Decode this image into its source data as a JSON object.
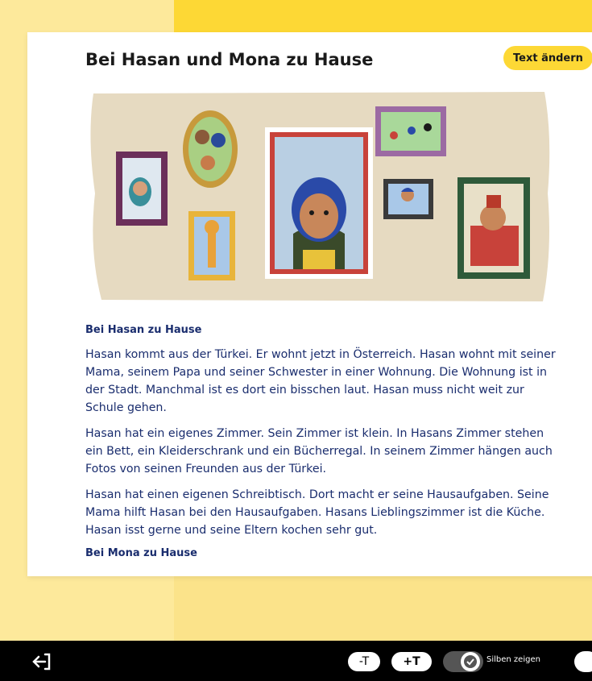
{
  "page": {
    "title": "Bei Hasan und Mona zu Hause",
    "edit_button": "Text ändern"
  },
  "colors": {
    "accent": "#fdd835",
    "text_blue": "#1a2d6e",
    "syllable_red": "#e02020"
  },
  "illustration": {
    "semantic": "family-portrait-wall-illustration"
  },
  "content": {
    "heading": "Bei Hasan zu Hause",
    "paragraphs": [
      "Hasan kommt aus der Türkei. Er wohnt jetzt in Österreich. Hasan wohnt mit seiner Mama, seinem Papa und seiner Schwester in einer Wohnung. Die Wohnung ist in der Stadt. Manchmal ist es dort ein bisschen laut. Hasan muss nicht weit zur Schule gehen.",
      "Hasan hat ein eigenes Zimmer. Sein Zimmer ist klein. In Hasans Zimmer stehen ein Bett, ein Kleiderschrank und ein Bücherregal. In seinem Zimmer hängen auch Fotos von seinen Freunden aus der Türkei.",
      "Hasan hat einen eigenen Schreibtisch. Dort macht er seine Hausaufgaben. Seine Mama hilft Hasan bei den Hausaufgaben. Hasans Lieblingszimmer ist die Küche. Hasan isst gerne und seine Eltern kochen sehr gut."
    ],
    "next_heading": "Bei Mona zu Hause"
  },
  "toolbar": {
    "back_icon": "exit-icon",
    "smaller_text": "-T",
    "larger_text": "+T",
    "syllables_label": "Silben zeigen",
    "syllables_on": true
  }
}
